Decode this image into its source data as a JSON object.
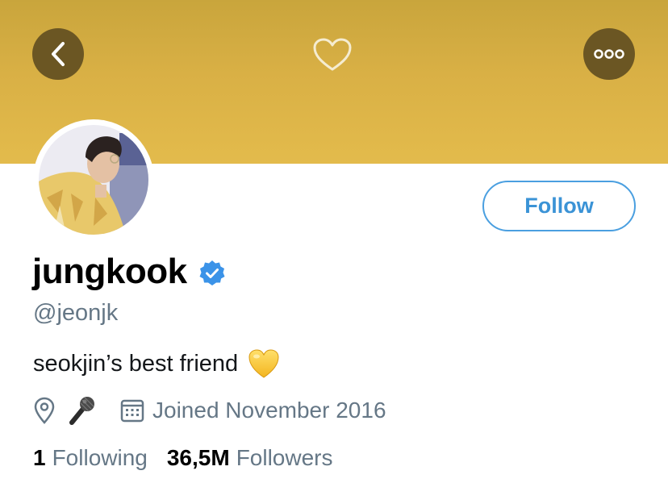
{
  "banner": {
    "color": "#e3bb4c"
  },
  "nav": {
    "back_icon": "chevron-left-icon",
    "like_icon": "heart-outline-icon",
    "more_icon": "more-dots-icon"
  },
  "profile": {
    "display_name": "jungkook",
    "verified_icon": "verified-badge-icon",
    "handle": "@jeonjk",
    "bio_text": "seokjin’s best friend",
    "bio_emoji": "yellow-heart-emoji",
    "location_emoji": "microphone-emoji",
    "joined": "Joined November 2016",
    "follow_label": "Follow",
    "accent_color": "#3b93d6"
  },
  "stats": {
    "following_count": "1",
    "following_label": "Following",
    "followers_count": "36,5M",
    "followers_label": "Followers"
  }
}
